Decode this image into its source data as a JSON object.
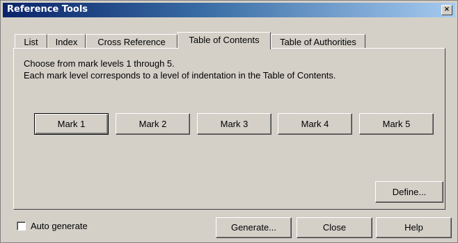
{
  "window": {
    "title": "Reference Tools",
    "close_glyph": "×"
  },
  "tabs": [
    {
      "label": "List",
      "active": false
    },
    {
      "label": "Index",
      "active": false
    },
    {
      "label": "Cross Reference",
      "active": false
    },
    {
      "label": "Table of Contents",
      "active": true
    },
    {
      "label": "Table of Authorities",
      "active": false
    }
  ],
  "panel": {
    "line1": "Choose from mark levels 1 through 5.",
    "line2": "Each mark level corresponds to a level of indentation in the Table of Contents.",
    "marks": [
      "Mark 1",
      "Mark 2",
      "Mark 3",
      "Mark 4",
      "Mark 5"
    ],
    "define_label": "Define..."
  },
  "footer": {
    "auto_generate_label": "Auto generate",
    "auto_generate_checked": false,
    "generate_label": "Generate...",
    "close_label": "Close",
    "help_label": "Help"
  }
}
